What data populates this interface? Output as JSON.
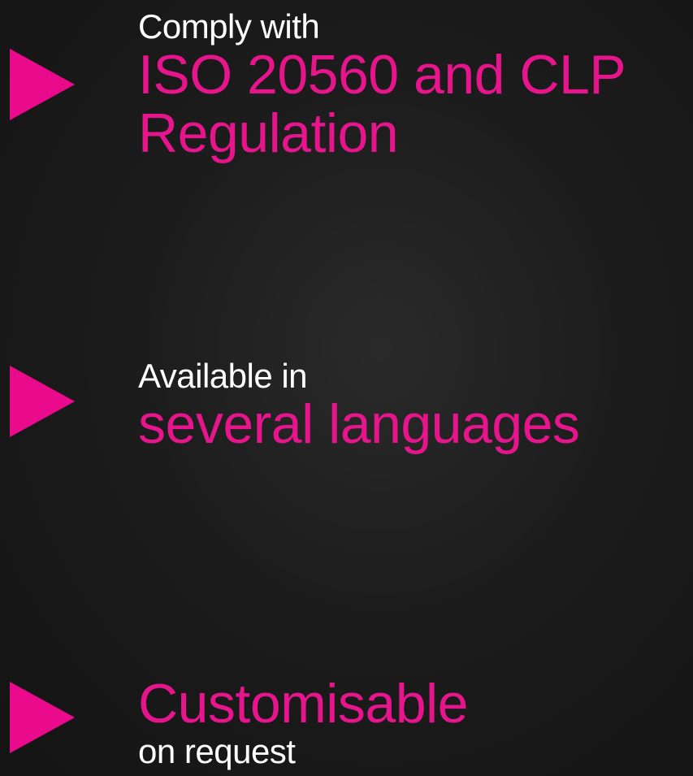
{
  "features": [
    {
      "lead": "Comply with",
      "highlight_line1": "ISO 20560 and CLP",
      "highlight_line2": "Regulation"
    },
    {
      "lead": "Available in",
      "highlight": "several languages"
    },
    {
      "highlight": "Customisable",
      "trail": "on request"
    }
  ],
  "colors": {
    "accent": "#e6158c",
    "arrow": "#ea0a8c",
    "background": "#1c1c1c",
    "text": "#ffffff"
  },
  "icons": {
    "bullet": "play-triangle-icon"
  }
}
